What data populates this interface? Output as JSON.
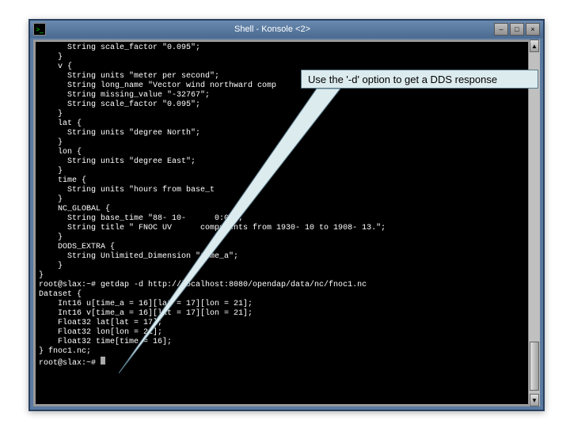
{
  "window": {
    "title": "Shell - Konsole <2>",
    "icon_glyph": ">_",
    "buttons": {
      "min": "–",
      "max": "□",
      "close": "×"
    }
  },
  "callout": {
    "text": "Use the '-d' option to get a DDS response"
  },
  "terminal": {
    "lines": [
      "      String scale_factor \"0.095\";",
      "    }",
      "    v {",
      "      String units \"meter per second\";",
      "      String long_name \"Vector wind northward comp",
      "      String missing_value \"-32767\";",
      "      String scale_factor \"0.095\";",
      "    }",
      "    lat {",
      "      String units \"degree North\";",
      "    }",
      "    lon {",
      "      String units \"degree East\";",
      "    }",
      "    time {",
      "      String units \"hours from base_t",
      "    }",
      "    NC_GLOBAL {",
      "      String base_time \"88- 10-      0:08\";",
      "      String title \" FNOC UV      components from 1930- 10 to 1908- 13.\";",
      "    }",
      "    DODS_EXTRA {",
      "      String Unlimited_Dimension \"time_a\";",
      "    }",
      "}",
      "root@slax:~# getdap -d http://localhost:8080/opendap/data/nc/fnoc1.nc",
      "Dataset {",
      "    Int16 u[time_a = 16][lat = 17][lon = 21];",
      "    Int16 v[time_a = 16][lat = 17][lon = 21];",
      "    Float32 lat[lat = 17];",
      "    Float32 lon[lon = 21];",
      "    Float32 time[time = 16];",
      "} fnoc1.nc;",
      "root@slax:~# "
    ]
  }
}
